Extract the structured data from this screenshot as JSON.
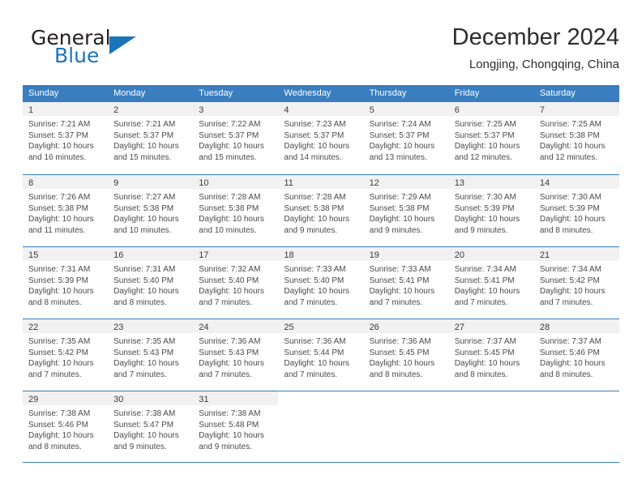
{
  "logo": {
    "word1": "General",
    "word2": "Blue",
    "triangle_color": "#1b75bb"
  },
  "header": {
    "title": "December 2024",
    "subtitle": "Longjing, Chongqing, China"
  },
  "theme": {
    "header_blue": "#3a7ebf",
    "day_band_gray": "#f1f1f1",
    "text_color": "#4a4a4a"
  },
  "weekdays": [
    "Sunday",
    "Monday",
    "Tuesday",
    "Wednesday",
    "Thursday",
    "Friday",
    "Saturday"
  ],
  "weeks": [
    [
      {
        "day": "1",
        "sunrise": "Sunrise: 7:21 AM",
        "sunset": "Sunset: 5:37 PM",
        "daylight_1": "Daylight: 10 hours",
        "daylight_2": "and 16 minutes."
      },
      {
        "day": "2",
        "sunrise": "Sunrise: 7:21 AM",
        "sunset": "Sunset: 5:37 PM",
        "daylight_1": "Daylight: 10 hours",
        "daylight_2": "and 15 minutes."
      },
      {
        "day": "3",
        "sunrise": "Sunrise: 7:22 AM",
        "sunset": "Sunset: 5:37 PM",
        "daylight_1": "Daylight: 10 hours",
        "daylight_2": "and 15 minutes."
      },
      {
        "day": "4",
        "sunrise": "Sunrise: 7:23 AM",
        "sunset": "Sunset: 5:37 PM",
        "daylight_1": "Daylight: 10 hours",
        "daylight_2": "and 14 minutes."
      },
      {
        "day": "5",
        "sunrise": "Sunrise: 7:24 AM",
        "sunset": "Sunset: 5:37 PM",
        "daylight_1": "Daylight: 10 hours",
        "daylight_2": "and 13 minutes."
      },
      {
        "day": "6",
        "sunrise": "Sunrise: 7:25 AM",
        "sunset": "Sunset: 5:37 PM",
        "daylight_1": "Daylight: 10 hours",
        "daylight_2": "and 12 minutes."
      },
      {
        "day": "7",
        "sunrise": "Sunrise: 7:25 AM",
        "sunset": "Sunset: 5:38 PM",
        "daylight_1": "Daylight: 10 hours",
        "daylight_2": "and 12 minutes."
      }
    ],
    [
      {
        "day": "8",
        "sunrise": "Sunrise: 7:26 AM",
        "sunset": "Sunset: 5:38 PM",
        "daylight_1": "Daylight: 10 hours",
        "daylight_2": "and 11 minutes."
      },
      {
        "day": "9",
        "sunrise": "Sunrise: 7:27 AM",
        "sunset": "Sunset: 5:38 PM",
        "daylight_1": "Daylight: 10 hours",
        "daylight_2": "and 10 minutes."
      },
      {
        "day": "10",
        "sunrise": "Sunrise: 7:28 AM",
        "sunset": "Sunset: 5:38 PM",
        "daylight_1": "Daylight: 10 hours",
        "daylight_2": "and 10 minutes."
      },
      {
        "day": "11",
        "sunrise": "Sunrise: 7:28 AM",
        "sunset": "Sunset: 5:38 PM",
        "daylight_1": "Daylight: 10 hours",
        "daylight_2": "and 9 minutes."
      },
      {
        "day": "12",
        "sunrise": "Sunrise: 7:29 AM",
        "sunset": "Sunset: 5:38 PM",
        "daylight_1": "Daylight: 10 hours",
        "daylight_2": "and 9 minutes."
      },
      {
        "day": "13",
        "sunrise": "Sunrise: 7:30 AM",
        "sunset": "Sunset: 5:39 PM",
        "daylight_1": "Daylight: 10 hours",
        "daylight_2": "and 9 minutes."
      },
      {
        "day": "14",
        "sunrise": "Sunrise: 7:30 AM",
        "sunset": "Sunset: 5:39 PM",
        "daylight_1": "Daylight: 10 hours",
        "daylight_2": "and 8 minutes."
      }
    ],
    [
      {
        "day": "15",
        "sunrise": "Sunrise: 7:31 AM",
        "sunset": "Sunset: 5:39 PM",
        "daylight_1": "Daylight: 10 hours",
        "daylight_2": "and 8 minutes."
      },
      {
        "day": "16",
        "sunrise": "Sunrise: 7:31 AM",
        "sunset": "Sunset: 5:40 PM",
        "daylight_1": "Daylight: 10 hours",
        "daylight_2": "and 8 minutes."
      },
      {
        "day": "17",
        "sunrise": "Sunrise: 7:32 AM",
        "sunset": "Sunset: 5:40 PM",
        "daylight_1": "Daylight: 10 hours",
        "daylight_2": "and 7 minutes."
      },
      {
        "day": "18",
        "sunrise": "Sunrise: 7:33 AM",
        "sunset": "Sunset: 5:40 PM",
        "daylight_1": "Daylight: 10 hours",
        "daylight_2": "and 7 minutes."
      },
      {
        "day": "19",
        "sunrise": "Sunrise: 7:33 AM",
        "sunset": "Sunset: 5:41 PM",
        "daylight_1": "Daylight: 10 hours",
        "daylight_2": "and 7 minutes."
      },
      {
        "day": "20",
        "sunrise": "Sunrise: 7:34 AM",
        "sunset": "Sunset: 5:41 PM",
        "daylight_1": "Daylight: 10 hours",
        "daylight_2": "and 7 minutes."
      },
      {
        "day": "21",
        "sunrise": "Sunrise: 7:34 AM",
        "sunset": "Sunset: 5:42 PM",
        "daylight_1": "Daylight: 10 hours",
        "daylight_2": "and 7 minutes."
      }
    ],
    [
      {
        "day": "22",
        "sunrise": "Sunrise: 7:35 AM",
        "sunset": "Sunset: 5:42 PM",
        "daylight_1": "Daylight: 10 hours",
        "daylight_2": "and 7 minutes."
      },
      {
        "day": "23",
        "sunrise": "Sunrise: 7:35 AM",
        "sunset": "Sunset: 5:43 PM",
        "daylight_1": "Daylight: 10 hours",
        "daylight_2": "and 7 minutes."
      },
      {
        "day": "24",
        "sunrise": "Sunrise: 7:36 AM",
        "sunset": "Sunset: 5:43 PM",
        "daylight_1": "Daylight: 10 hours",
        "daylight_2": "and 7 minutes."
      },
      {
        "day": "25",
        "sunrise": "Sunrise: 7:36 AM",
        "sunset": "Sunset: 5:44 PM",
        "daylight_1": "Daylight: 10 hours",
        "daylight_2": "and 7 minutes."
      },
      {
        "day": "26",
        "sunrise": "Sunrise: 7:36 AM",
        "sunset": "Sunset: 5:45 PM",
        "daylight_1": "Daylight: 10 hours",
        "daylight_2": "and 8 minutes."
      },
      {
        "day": "27",
        "sunrise": "Sunrise: 7:37 AM",
        "sunset": "Sunset: 5:45 PM",
        "daylight_1": "Daylight: 10 hours",
        "daylight_2": "and 8 minutes."
      },
      {
        "day": "28",
        "sunrise": "Sunrise: 7:37 AM",
        "sunset": "Sunset: 5:46 PM",
        "daylight_1": "Daylight: 10 hours",
        "daylight_2": "and 8 minutes."
      }
    ],
    [
      {
        "day": "29",
        "sunrise": "Sunrise: 7:38 AM",
        "sunset": "Sunset: 5:46 PM",
        "daylight_1": "Daylight: 10 hours",
        "daylight_2": "and 8 minutes."
      },
      {
        "day": "30",
        "sunrise": "Sunrise: 7:38 AM",
        "sunset": "Sunset: 5:47 PM",
        "daylight_1": "Daylight: 10 hours",
        "daylight_2": "and 9 minutes."
      },
      {
        "day": "31",
        "sunrise": "Sunrise: 7:38 AM",
        "sunset": "Sunset: 5:48 PM",
        "daylight_1": "Daylight: 10 hours",
        "daylight_2": "and 9 minutes."
      },
      {
        "day": "",
        "sunrise": "",
        "sunset": "",
        "daylight_1": "",
        "daylight_2": ""
      },
      {
        "day": "",
        "sunrise": "",
        "sunset": "",
        "daylight_1": "",
        "daylight_2": ""
      },
      {
        "day": "",
        "sunrise": "",
        "sunset": "",
        "daylight_1": "",
        "daylight_2": ""
      },
      {
        "day": "",
        "sunrise": "",
        "sunset": "",
        "daylight_1": "",
        "daylight_2": ""
      }
    ]
  ]
}
